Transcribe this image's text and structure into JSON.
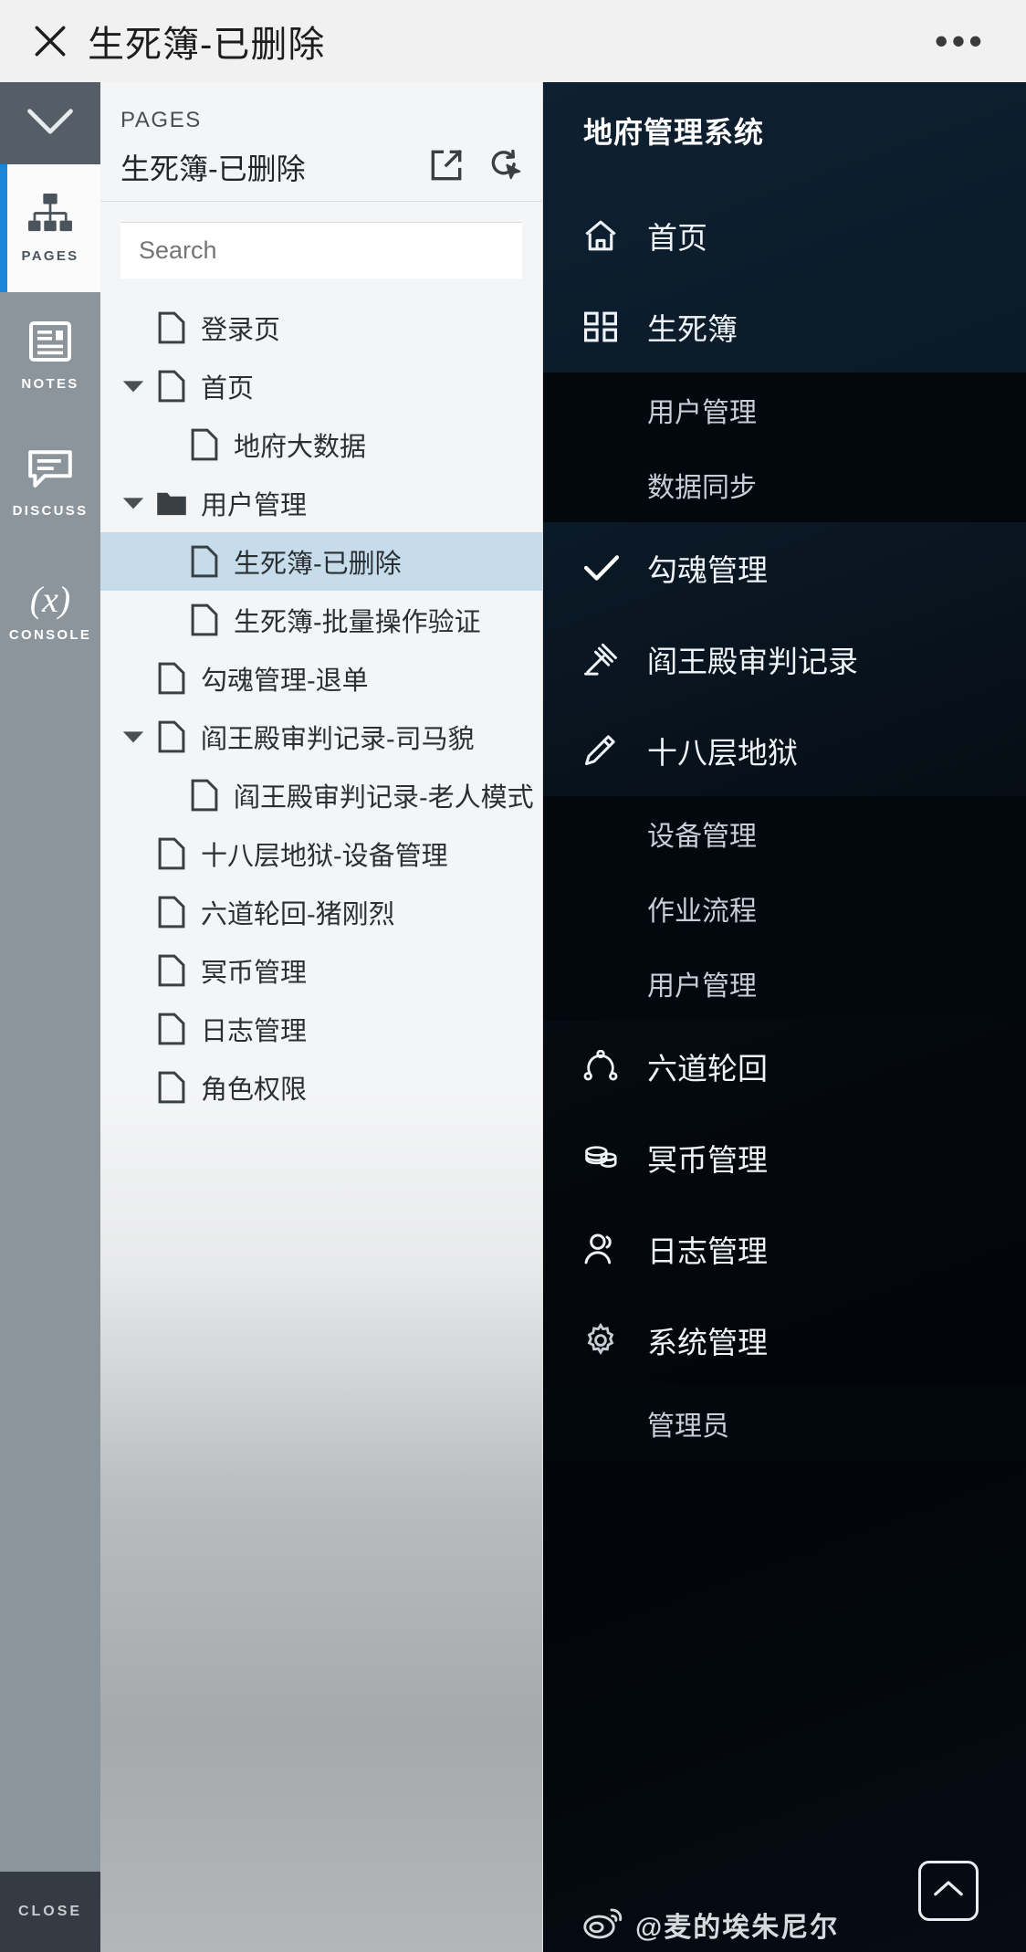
{
  "topbar": {
    "close_icon": "close-x-icon",
    "title": "生死簿-已删除",
    "more_label": "•••"
  },
  "rail": {
    "collapse_icon": "chevron-down-icon",
    "items": [
      {
        "label": "PAGES",
        "icon": "sitemap-icon",
        "active": true
      },
      {
        "label": "NOTES",
        "icon": "notes-icon",
        "active": false
      },
      {
        "label": "DISCUSS",
        "icon": "comment-icon",
        "active": false
      },
      {
        "label": "CONSOLE",
        "icon": "variable-x-icon",
        "active": false
      }
    ],
    "close_label": "CLOSE"
  },
  "pages_panel": {
    "kicker": "PAGES",
    "doc_title": "生死簿-已删除",
    "share_icon": "external-link-icon",
    "refresh_icon": "refresh-cursor-icon",
    "search_placeholder": "Search",
    "search_value": "",
    "tree": [
      {
        "label": "登录页",
        "icon": "page-icon",
        "indent": 1,
        "caret": "none",
        "selected": false
      },
      {
        "label": "首页",
        "icon": "page-icon",
        "indent": 1,
        "caret": "expanded",
        "selected": false
      },
      {
        "label": "地府大数据",
        "icon": "page-icon",
        "indent": 2,
        "caret": "none",
        "selected": false
      },
      {
        "label": "用户管理",
        "icon": "folder-icon",
        "indent": 1,
        "caret": "expanded",
        "selected": false
      },
      {
        "label": "生死簿-已删除",
        "icon": "page-icon",
        "indent": 2,
        "caret": "none",
        "selected": true
      },
      {
        "label": "生死簿-批量操作验证",
        "icon": "page-icon",
        "indent": 2,
        "caret": "none",
        "selected": false
      },
      {
        "label": "勾魂管理-退单",
        "icon": "page-icon",
        "indent": 1,
        "caret": "none",
        "selected": false
      },
      {
        "label": "阎王殿审判记录-司马貌",
        "icon": "page-icon",
        "indent": 1,
        "caret": "expanded",
        "selected": false
      },
      {
        "label": "阎王殿审判记录-老人模式",
        "icon": "page-icon",
        "indent": 2,
        "caret": "none",
        "selected": false
      },
      {
        "label": "十八层地狱-设备管理",
        "icon": "page-icon",
        "indent": 1,
        "caret": "none",
        "selected": false
      },
      {
        "label": "六道轮回-猪刚烈",
        "icon": "page-icon",
        "indent": 1,
        "caret": "none",
        "selected": false
      },
      {
        "label": "冥币管理",
        "icon": "page-icon",
        "indent": 1,
        "caret": "none",
        "selected": false
      },
      {
        "label": "日志管理",
        "icon": "page-icon",
        "indent": 1,
        "caret": "none",
        "selected": false
      },
      {
        "label": "角色权限",
        "icon": "page-icon",
        "indent": 1,
        "caret": "none",
        "selected": false
      }
    ]
  },
  "darknav": {
    "brand": "地府管理系统",
    "items": [
      {
        "label": "首页",
        "icon": "home-icon",
        "type": "item"
      },
      {
        "label": "生死簿",
        "icon": "grid-icon",
        "type": "item"
      },
      {
        "label": "用户管理",
        "icon": "",
        "type": "sub"
      },
      {
        "label": "数据同步",
        "icon": "",
        "type": "sub"
      },
      {
        "label": "勾魂管理",
        "icon": "check-icon",
        "type": "item"
      },
      {
        "label": "阎王殿审判记录",
        "icon": "gavel-icon",
        "type": "item"
      },
      {
        "label": "十八层地狱",
        "icon": "pen-icon",
        "type": "item"
      },
      {
        "label": "设备管理",
        "icon": "",
        "type": "sub"
      },
      {
        "label": "作业流程",
        "icon": "",
        "type": "sub"
      },
      {
        "label": "用户管理",
        "icon": "",
        "type": "sub"
      },
      {
        "label": "六道轮回",
        "icon": "orbit-icon",
        "type": "item"
      },
      {
        "label": "冥币管理",
        "icon": "coins-icon",
        "type": "item"
      },
      {
        "label": "日志管理",
        "icon": "user-icon",
        "type": "item"
      },
      {
        "label": "系统管理",
        "icon": "gear-icon",
        "type": "item"
      },
      {
        "label": "管理员",
        "icon": "",
        "type": "sub"
      }
    ],
    "scroll_top_icon": "chevron-up-icon"
  },
  "watermark": {
    "icon": "weibo-icon",
    "text": "@麦的埃朱尼尔"
  }
}
